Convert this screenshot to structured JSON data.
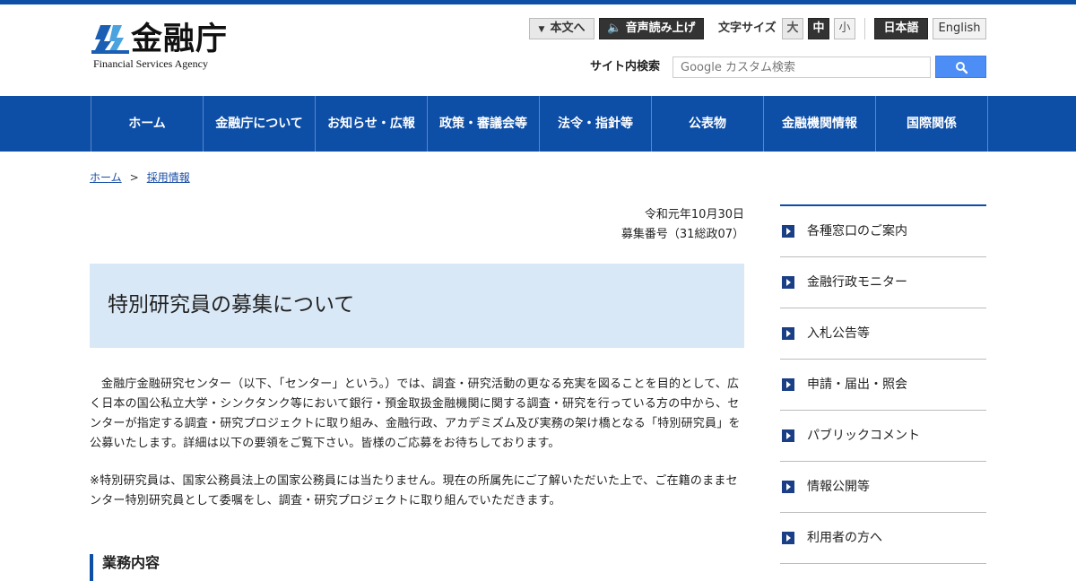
{
  "brand": {
    "title": "金融庁",
    "subtitle": "Financial Services Agency"
  },
  "utility": {
    "skip_label": "本文へ",
    "voice_label": "音声読み上げ",
    "font_size_label": "文字サイズ",
    "font_sizes": [
      "大",
      "中",
      "小"
    ],
    "lang_ja": "日本語",
    "lang_en": "English"
  },
  "search": {
    "label": "サイト内検索",
    "placeholder": "Google カスタム検索"
  },
  "nav": [
    "ホーム",
    "金融庁について",
    "お知らせ・広報",
    "政策・審議会等",
    "法令・指針等",
    "公表物",
    "金融機関情報",
    "国際関係"
  ],
  "breadcrumb": {
    "home": "ホーム",
    "separator": ">",
    "current": "採用情報"
  },
  "main": {
    "date": "令和元年10月30日",
    "recruit_no": "募集番号（31総政07）",
    "title": "特別研究員の募集について",
    "p1": "金融庁金融研究センター（以下、「センター」という。）では、調査・研究活動の更なる充実を図ることを目的として、広く日本の国公私立大学・シンクタンク等において銀行・預金取扱金融機関に関する調査・研究を行っている方の中から、センターが指定する調査・研究プロジェクトに取り組み、金融行政、アカデミズム及び実務の架け橋となる「特別研究員」を公募いたします。詳細は以下の要領をご覧下さい。皆様のご応募をお待ちしております。",
    "p2": "※特別研究員は、国家公務員法上の国家公務員には当たりません。現在の所属先にご了解いただいた上で、ご在籍のままセンター特別研究員として委嘱をし、調査・研究プロジェクトに取り組んでいただきます。",
    "section_heading": "業務内容"
  },
  "sidebar": [
    "各種窓口のご案内",
    "金融行政モニター",
    "入札公告等",
    "申請・届出・照会",
    "パブリックコメント",
    "情報公開等",
    "利用者の方へ"
  ],
  "colors": {
    "brand_blue": "#0d4ea6",
    "title_bg": "#d9e8f6",
    "search_button": "#4c8ef5"
  }
}
